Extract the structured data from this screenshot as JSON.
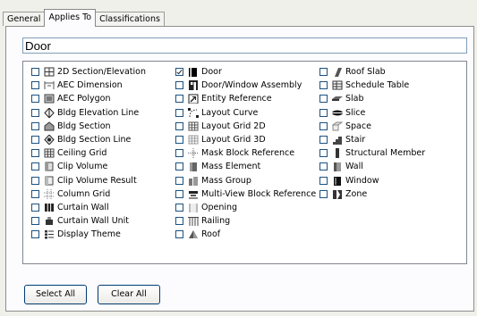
{
  "tabs": [
    {
      "label": "General"
    },
    {
      "label": "Applies To"
    },
    {
      "label": "Classifications"
    }
  ],
  "search": {
    "value": "Door"
  },
  "columns": [
    [
      {
        "label": "2D Section/Elevation",
        "checked": false,
        "icon": "2d-section-icon"
      },
      {
        "label": "AEC Dimension",
        "checked": false,
        "icon": "aec-dimension-icon"
      },
      {
        "label": "AEC Polygon",
        "checked": false,
        "icon": "aec-polygon-icon"
      },
      {
        "label": "Bldg Elevation Line",
        "checked": false,
        "icon": "bldg-elevation-line-icon"
      },
      {
        "label": "Bldg Section",
        "checked": false,
        "icon": "bldg-section-icon"
      },
      {
        "label": "Bldg Section Line",
        "checked": false,
        "icon": "bldg-section-line-icon"
      },
      {
        "label": "Ceiling Grid",
        "checked": false,
        "icon": "ceiling-grid-icon"
      },
      {
        "label": "Clip Volume",
        "checked": false,
        "icon": "clip-volume-icon"
      },
      {
        "label": "Clip Volume Result",
        "checked": false,
        "icon": "clip-volume-result-icon"
      },
      {
        "label": "Column Grid",
        "checked": false,
        "icon": "column-grid-icon"
      },
      {
        "label": "Curtain Wall",
        "checked": false,
        "icon": "curtain-wall-icon"
      },
      {
        "label": "Curtain Wall Unit",
        "checked": false,
        "icon": "curtain-wall-unit-icon"
      },
      {
        "label": "Display Theme",
        "checked": false,
        "icon": "display-theme-icon"
      }
    ],
    [
      {
        "label": "Door",
        "checked": true,
        "icon": "door-icon"
      },
      {
        "label": "Door/Window Assembly",
        "checked": false,
        "icon": "door-window-assembly-icon"
      },
      {
        "label": "Entity Reference",
        "checked": false,
        "icon": "entity-reference-icon"
      },
      {
        "label": "Layout Curve",
        "checked": false,
        "icon": "layout-curve-icon"
      },
      {
        "label": "Layout Grid 2D",
        "checked": false,
        "icon": "layout-grid-2d-icon"
      },
      {
        "label": "Layout Grid 3D",
        "checked": false,
        "icon": "layout-grid-3d-icon"
      },
      {
        "label": "Mask Block Reference",
        "checked": false,
        "icon": "mask-block-reference-icon"
      },
      {
        "label": "Mass Element",
        "checked": false,
        "icon": "mass-element-icon"
      },
      {
        "label": "Mass Group",
        "checked": false,
        "icon": "mass-group-icon"
      },
      {
        "label": "Multi-View Block Reference",
        "checked": false,
        "icon": "multi-view-block-reference-icon"
      },
      {
        "label": "Opening",
        "checked": false,
        "icon": "opening-icon"
      },
      {
        "label": "Railing",
        "checked": false,
        "icon": "railing-icon"
      },
      {
        "label": "Roof",
        "checked": false,
        "icon": "roof-icon"
      }
    ],
    [
      {
        "label": "Roof Slab",
        "checked": false,
        "icon": "roof-slab-icon"
      },
      {
        "label": "Schedule Table",
        "checked": false,
        "icon": "schedule-table-icon"
      },
      {
        "label": "Slab",
        "checked": false,
        "icon": "slab-icon"
      },
      {
        "label": "Slice",
        "checked": false,
        "icon": "slice-icon"
      },
      {
        "label": "Space",
        "checked": false,
        "icon": "space-icon"
      },
      {
        "label": "Stair",
        "checked": false,
        "icon": "stair-icon"
      },
      {
        "label": "Structural Member",
        "checked": false,
        "icon": "structural-member-icon"
      },
      {
        "label": "Wall",
        "checked": false,
        "icon": "wall-icon"
      },
      {
        "label": "Window",
        "checked": false,
        "icon": "window-icon"
      },
      {
        "label": "Zone",
        "checked": false,
        "icon": "zone-icon"
      }
    ]
  ],
  "buttons": {
    "select_all": "Select All",
    "clear_all": "Clear All"
  }
}
